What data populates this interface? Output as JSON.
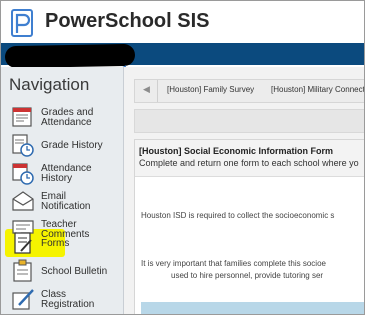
{
  "app": {
    "title": "PowerSchool SIS"
  },
  "sidebar": {
    "title": "Navigation",
    "items": [
      {
        "label_line1": "Grades and",
        "label_line2": "Attendance",
        "icon": "grades-attendance-icon"
      },
      {
        "label_line1": "Grade History",
        "label_line2": "",
        "icon": "grade-history-icon"
      },
      {
        "label_line1": "Attendance",
        "label_line2": "History",
        "icon": "attendance-history-icon"
      },
      {
        "label_line1": "Email",
        "label_line2": "Notification",
        "icon": "email-notification-icon"
      },
      {
        "label_line1": "Teacher",
        "label_line2": "Comments",
        "icon": "teacher-comments-icon"
      },
      {
        "label_line1": "Forms",
        "label_line2": "",
        "icon": "forms-icon"
      },
      {
        "label_line1": "School Bulletin",
        "label_line2": "",
        "icon": "school-bulletin-icon"
      },
      {
        "label_line1": "Class",
        "label_line2": "Registration",
        "icon": "class-registration-icon"
      }
    ],
    "highlight_color": "#f5f300"
  },
  "tabs": [
    {
      "label": "[Houston] Family Survey"
    },
    {
      "label": "[Houston] Military Connecte"
    }
  ],
  "panel": {
    "title": "[Houston] Social Economic Information Form",
    "subtitle": "Complete and return one form to each school where yo",
    "text1": "Houston ISD is required to collect the socioeconomic s",
    "text2_line1": "It is very important that families complete this socioe",
    "text2_line2": "used to hire personnel, provide tutoring ser"
  },
  "colors": {
    "header_bar": "#0b4a7e",
    "logo": "#3f7fd0"
  }
}
